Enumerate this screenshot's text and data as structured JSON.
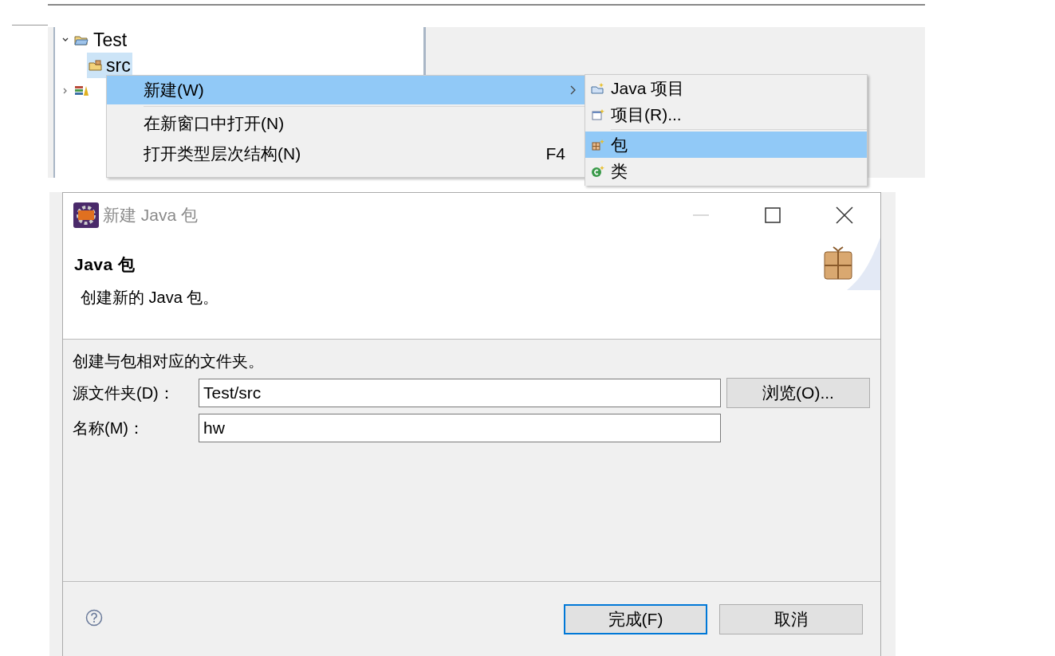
{
  "tree": {
    "items": [
      {
        "label": "Test",
        "expanded": true,
        "children": [
          {
            "label": "src",
            "selected": true
          }
        ]
      },
      {
        "expanded": false
      }
    ]
  },
  "context_menu": {
    "items": [
      {
        "kind": "item",
        "label": "新建(W)",
        "selected": true,
        "submenu": true
      },
      {
        "kind": "separator"
      },
      {
        "kind": "item",
        "label": "在新窗口中打开(N)",
        "selected": false,
        "submenu": false
      },
      {
        "kind": "item",
        "label": "打开类型层次结构(N)",
        "shortcut": "F4",
        "selected": false,
        "submenu": false
      }
    ]
  },
  "submenu": {
    "items": [
      {
        "kind": "item",
        "label": "Java 项目",
        "selected": false
      },
      {
        "kind": "item",
        "label": "项目(R)...",
        "selected": false
      },
      {
        "kind": "separator"
      },
      {
        "kind": "item",
        "label": "包",
        "selected": true
      },
      {
        "kind": "item",
        "label": "类",
        "selected": false
      }
    ]
  },
  "dialog": {
    "title": "新建 Java 包",
    "header_title": "Java 包",
    "description": "创建新的 Java 包。",
    "instructions": "创建与包相对应的文件夹。",
    "fields": [
      {
        "label": "源文件夹(D)：",
        "value": "Test/src",
        "button": "浏览(O)..."
      },
      {
        "label": "名称(M)：",
        "value": "hw"
      }
    ],
    "buttons": [
      {
        "label": "完成(F)",
        "default": true
      },
      {
        "label": "取消",
        "default": false
      }
    ]
  }
}
